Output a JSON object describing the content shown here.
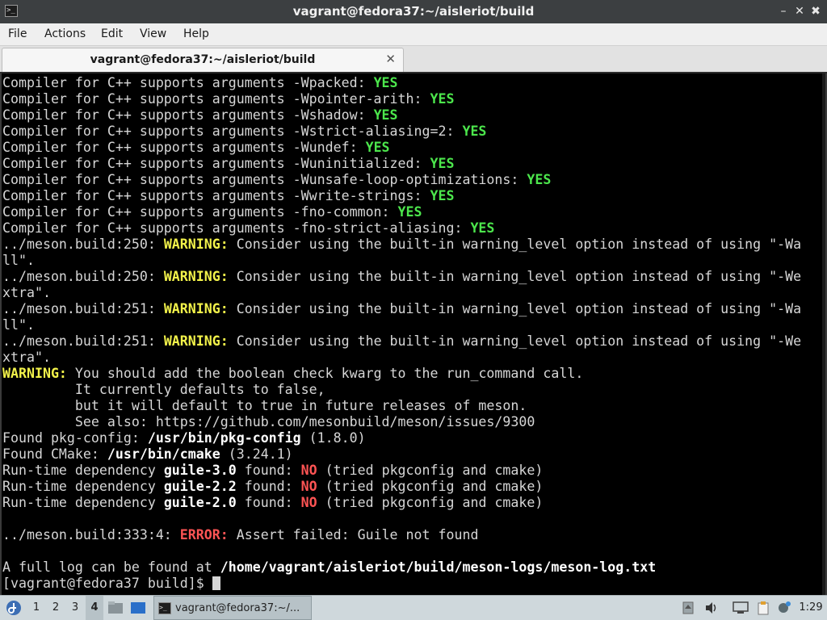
{
  "window": {
    "title": "vagrant@fedora37:~/aisleriot/build",
    "app_icon": "terminal-icon",
    "min_glyph": "–",
    "max_glyph": "✕",
    "close_glyph": "✖"
  },
  "menu": [
    "File",
    "Actions",
    "Edit",
    "View",
    "Help"
  ],
  "tab": {
    "label": "vagrant@fedora37:~/aisleriot/build",
    "close_glyph": "✕"
  },
  "terminal_lines": [
    [
      [
        "",
        "Compiler for C++ supports arguments -Wpacked: "
      ],
      [
        "g",
        "YES"
      ]
    ],
    [
      [
        "",
        "Compiler for C++ supports arguments -Wpointer-arith: "
      ],
      [
        "g",
        "YES"
      ]
    ],
    [
      [
        "",
        "Compiler for C++ supports arguments -Wshadow: "
      ],
      [
        "g",
        "YES"
      ]
    ],
    [
      [
        "",
        "Compiler for C++ supports arguments -Wstrict-aliasing=2: "
      ],
      [
        "g",
        "YES"
      ]
    ],
    [
      [
        "",
        "Compiler for C++ supports arguments -Wundef: "
      ],
      [
        "g",
        "YES"
      ]
    ],
    [
      [
        "",
        "Compiler for C++ supports arguments -Wuninitialized: "
      ],
      [
        "g",
        "YES"
      ]
    ],
    [
      [
        "",
        "Compiler for C++ supports arguments -Wunsafe-loop-optimizations: "
      ],
      [
        "g",
        "YES"
      ]
    ],
    [
      [
        "",
        "Compiler for C++ supports arguments -Wwrite-strings: "
      ],
      [
        "g",
        "YES"
      ]
    ],
    [
      [
        "",
        "Compiler for C++ supports arguments -fno-common: "
      ],
      [
        "g",
        "YES"
      ]
    ],
    [
      [
        "",
        "Compiler for C++ supports arguments -fno-strict-aliasing: "
      ],
      [
        "g",
        "YES"
      ]
    ],
    [
      [
        "",
        "../meson.build:250: "
      ],
      [
        "y",
        "WARNING:"
      ],
      [
        "",
        " Consider using the built-in warning_level option instead of using \"-Wa"
      ]
    ],
    [
      [
        "",
        "ll\"."
      ]
    ],
    [
      [
        "",
        "../meson.build:250: "
      ],
      [
        "y",
        "WARNING:"
      ],
      [
        "",
        " Consider using the built-in warning_level option instead of using \"-We"
      ]
    ],
    [
      [
        "",
        "xtra\"."
      ]
    ],
    [
      [
        "",
        "../meson.build:251: "
      ],
      [
        "y",
        "WARNING:"
      ],
      [
        "",
        " Consider using the built-in warning_level option instead of using \"-Wa"
      ]
    ],
    [
      [
        "",
        "ll\"."
      ]
    ],
    [
      [
        "",
        "../meson.build:251: "
      ],
      [
        "y",
        "WARNING:"
      ],
      [
        "",
        " Consider using the built-in warning_level option instead of using \"-We"
      ]
    ],
    [
      [
        "",
        "xtra\"."
      ]
    ],
    [
      [
        "y",
        "WARNING:"
      ],
      [
        "",
        " You should add the boolean check kwarg to the run_command call."
      ]
    ],
    [
      [
        "",
        "         It currently defaults to false,"
      ]
    ],
    [
      [
        "",
        "         but it will default to true in future releases of meson."
      ]
    ],
    [
      [
        "",
        "         See also: https://github.com/mesonbuild/meson/issues/9300"
      ]
    ],
    [
      [
        "",
        "Found pkg-config: "
      ],
      [
        "b",
        "/usr/bin/pkg-config"
      ],
      [
        "",
        " (1.8.0)"
      ]
    ],
    [
      [
        "",
        "Found CMake: "
      ],
      [
        "b",
        "/usr/bin/cmake"
      ],
      [
        "",
        " (3.24.1)"
      ]
    ],
    [
      [
        "",
        "Run-time dependency "
      ],
      [
        "b",
        "guile-3.0"
      ],
      [
        "",
        " found: "
      ],
      [
        "r",
        "NO"
      ],
      [
        "",
        " (tried pkgconfig and cmake)"
      ]
    ],
    [
      [
        "",
        "Run-time dependency "
      ],
      [
        "b",
        "guile-2.2"
      ],
      [
        "",
        " found: "
      ],
      [
        "r",
        "NO"
      ],
      [
        "",
        " (tried pkgconfig and cmake)"
      ]
    ],
    [
      [
        "",
        "Run-time dependency "
      ],
      [
        "b",
        "guile-2.0"
      ],
      [
        "",
        " found: "
      ],
      [
        "r",
        "NO"
      ],
      [
        "",
        " (tried pkgconfig and cmake)"
      ]
    ],
    [
      [
        "",
        ""
      ]
    ],
    [
      [
        "",
        "../meson.build:333:4: "
      ],
      [
        "r",
        "ERROR:"
      ],
      [
        "",
        " Assert failed: Guile not found"
      ]
    ],
    [
      [
        "",
        ""
      ]
    ],
    [
      [
        "",
        "A full log can be found at "
      ],
      [
        "b",
        "/home/vagrant/aisleriot/build/meson-logs/meson-log.txt"
      ]
    ],
    [
      [
        "",
        "[vagrant@fedora37 build]$ "
      ],
      [
        "cursor",
        ""
      ]
    ]
  ],
  "taskbar": {
    "start_icon": "fedora-logo-icon",
    "workspaces": [
      "1",
      "2",
      "3",
      "4"
    ],
    "active_workspace": "4",
    "task_label": "vagrant@fedora37:~/...",
    "clock": "1:29"
  }
}
